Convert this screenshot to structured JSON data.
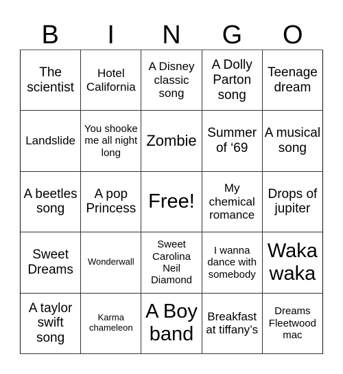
{
  "header": {
    "letters": [
      "B",
      "I",
      "N",
      "G",
      "O"
    ]
  },
  "grid": {
    "cells": [
      {
        "text": "The scientist",
        "size": "s-lg"
      },
      {
        "text": "Hotel California",
        "size": "s-md"
      },
      {
        "text": "A Disney classic song",
        "size": "s-md"
      },
      {
        "text": "A Dolly Parton song",
        "size": "s-lg"
      },
      {
        "text": "Teenage dream",
        "size": "s-lg"
      },
      {
        "text": "Landslide",
        "size": "s-md"
      },
      {
        "text": "You shooke me all night long",
        "size": "s-sm"
      },
      {
        "text": "Zombie",
        "size": "s-xl"
      },
      {
        "text": "Summer of ‘69",
        "size": "s-lg"
      },
      {
        "text": "A musical song",
        "size": "s-lg"
      },
      {
        "text": "A beetles song",
        "size": "s-lg"
      },
      {
        "text": "A pop Princess",
        "size": "s-lg"
      },
      {
        "text": "Free!",
        "size": "s-xxl"
      },
      {
        "text": "My chemical romance",
        "size": "s-md"
      },
      {
        "text": "Drops of jupiter",
        "size": "s-lg"
      },
      {
        "text": "Sweet Dreams",
        "size": "s-lg"
      },
      {
        "text": "Wonderwall",
        "size": "s-xs"
      },
      {
        "text": "Sweet Carolina Neil Diamond",
        "size": "s-sm"
      },
      {
        "text": "I wanna dance with somebody",
        "size": "s-sm"
      },
      {
        "text": "Waka waka",
        "size": "s-xxl"
      },
      {
        "text": "A taylor swift song",
        "size": "s-lg"
      },
      {
        "text": "Karma chameleon",
        "size": "s-xs"
      },
      {
        "text": "A Boy band",
        "size": "s-xxl"
      },
      {
        "text": "Breakfast at tiffany’s",
        "size": "s-md"
      },
      {
        "text": "Dreams Fleetwood mac",
        "size": "s-sm"
      }
    ]
  }
}
